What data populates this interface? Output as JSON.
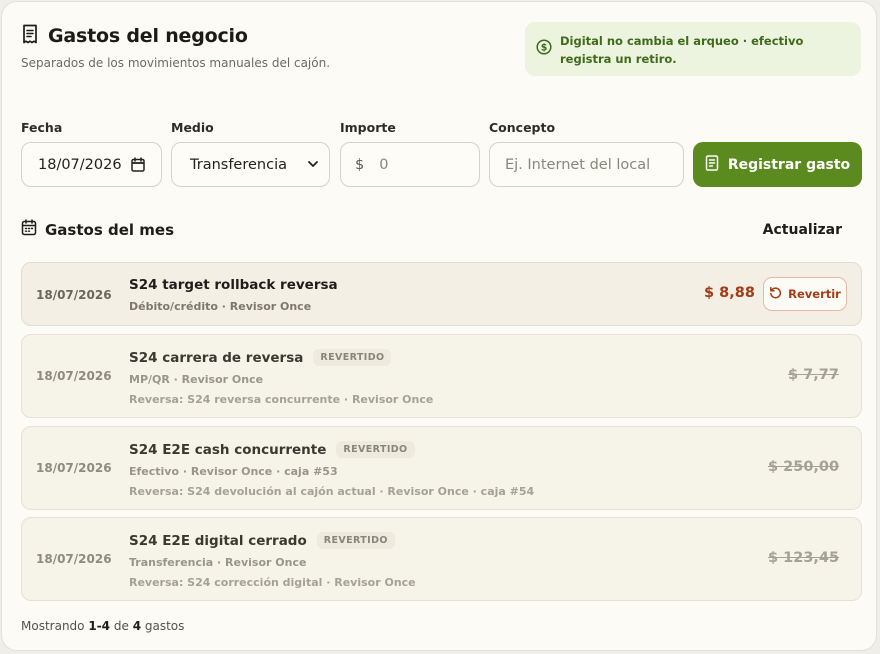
{
  "header": {
    "title": "Gastos del negocio",
    "subtitle": "Separados de los movimientos manuales del cajón."
  },
  "notice": {
    "text": "Digital no cambia el arqueo · efectivo registra un retiro."
  },
  "form": {
    "fecha_label": "Fecha",
    "fecha_value": "18/07/2026",
    "medio_label": "Medio",
    "medio_value": "Transferencia",
    "importe_label": "Importe",
    "importe_prefix": "$",
    "importe_placeholder": "0",
    "concepto_label": "Concepto",
    "concepto_placeholder": "Ej. Internet del local",
    "submit_label": "Registrar gasto"
  },
  "section": {
    "title": "Gastos del mes",
    "refresh_label": "Actualizar"
  },
  "expenses": [
    {
      "date": "18/07/2026",
      "name": "S24 target rollback reversa",
      "meta": "Débito/crédito · Revisor Once",
      "amount": "$ 8,88",
      "action_label": "Revertir"
    },
    {
      "date": "18/07/2026",
      "name": "S24 carrera de reversa",
      "badge": "REVERTIDO",
      "meta": "MP/QR · Revisor Once",
      "reversal": "Reversa: S24 reversa concurrente · Revisor Once",
      "amount": "$ 7,77"
    },
    {
      "date": "18/07/2026",
      "name": "S24 E2E cash concurrente",
      "badge": "REVERTIDO",
      "meta": "Efectivo · Revisor Once · caja #53",
      "reversal": "Reversa: S24 devolución al cajón actual · Revisor Once · caja #54",
      "amount": "$ 250,00"
    },
    {
      "date": "18/07/2026",
      "name": "S24 E2E digital cerrado",
      "badge": "REVERTIDO",
      "meta": "Transferencia · Revisor Once",
      "reversal": "Reversa: S24 corrección digital · Revisor Once",
      "amount": "$ 123,45"
    }
  ],
  "footer": {
    "prefix": "Mostrando",
    "range": "1-4",
    "of": "de",
    "total": "4",
    "suffix": "gastos"
  },
  "colors": {
    "primary": "#5b8a1f",
    "notice_bg": "#ecf3df",
    "danger": "#a03d17"
  }
}
